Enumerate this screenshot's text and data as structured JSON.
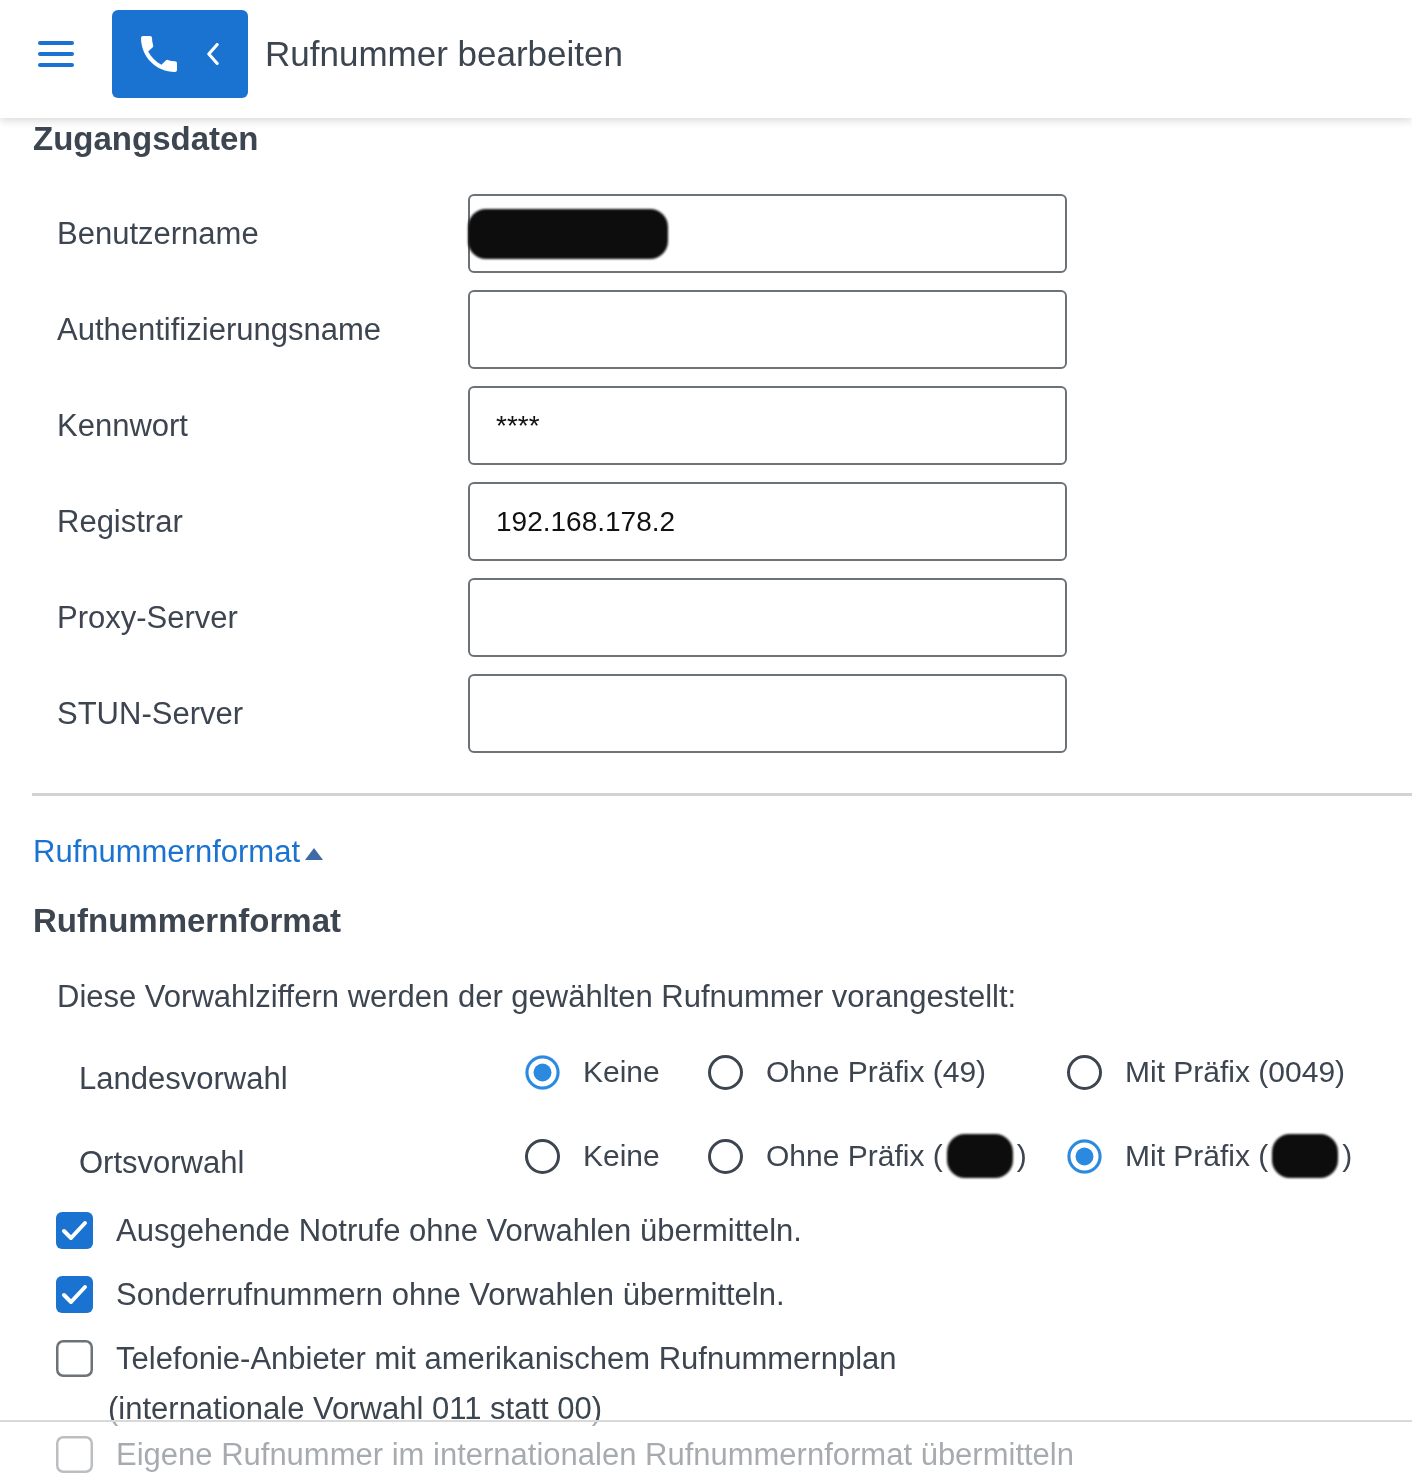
{
  "header": {
    "title": "Rufnummer bearbeiten"
  },
  "access": {
    "heading": "Zugangsdaten",
    "fields": [
      {
        "label": "Benutzername",
        "redacted": true
      },
      {
        "label": "Authentifizierungsname"
      },
      {
        "label": "Kennwort",
        "value": "****"
      },
      {
        "label": "Registrar",
        "value": "192.168.178.2"
      },
      {
        "label": "Proxy-Server"
      },
      {
        "label": "STUN-Server"
      }
    ]
  },
  "format_toggle": {
    "label": "Rufnummernformat",
    "expanded": true
  },
  "format": {
    "heading": "Rufnummernformat",
    "intro": "Diese Vorwahlziffern werden der gewählten Rufnummer vorangestellt:",
    "groups": [
      {
        "label": "Landesvorwahl",
        "options": [
          {
            "label": "Keine",
            "selected": true
          },
          {
            "label": "Ohne Präfix (49)",
            "selected": false
          },
          {
            "label": "Mit Präfix (0049)",
            "selected": false
          }
        ]
      },
      {
        "label": "Ortsvorwahl",
        "options": [
          {
            "label": "Keine",
            "selected": false
          },
          {
            "label": "Ohne Präfix (",
            "redacted": true,
            "label_end": ")",
            "selected": false
          },
          {
            "label": "Mit Präfix (",
            "redacted": true,
            "label_end": ")",
            "selected": true
          }
        ]
      }
    ],
    "checks": [
      {
        "label": "Ausgehende Notrufe ohne Vorwahlen übermitteln.",
        "checked": true
      },
      {
        "label": "Sonderrufnummern ohne Vorwahlen übermitteln.",
        "checked": true
      },
      {
        "label": "Telefonie-Anbieter mit amerikanischem Rufnummernplan",
        "note": "(internationale Vorwahl 011 statt 00)",
        "checked": false
      },
      {
        "label": "Eigene Rufnummer im internationalen Rufnummernformat übermitteln",
        "checked": false
      }
    ]
  }
}
